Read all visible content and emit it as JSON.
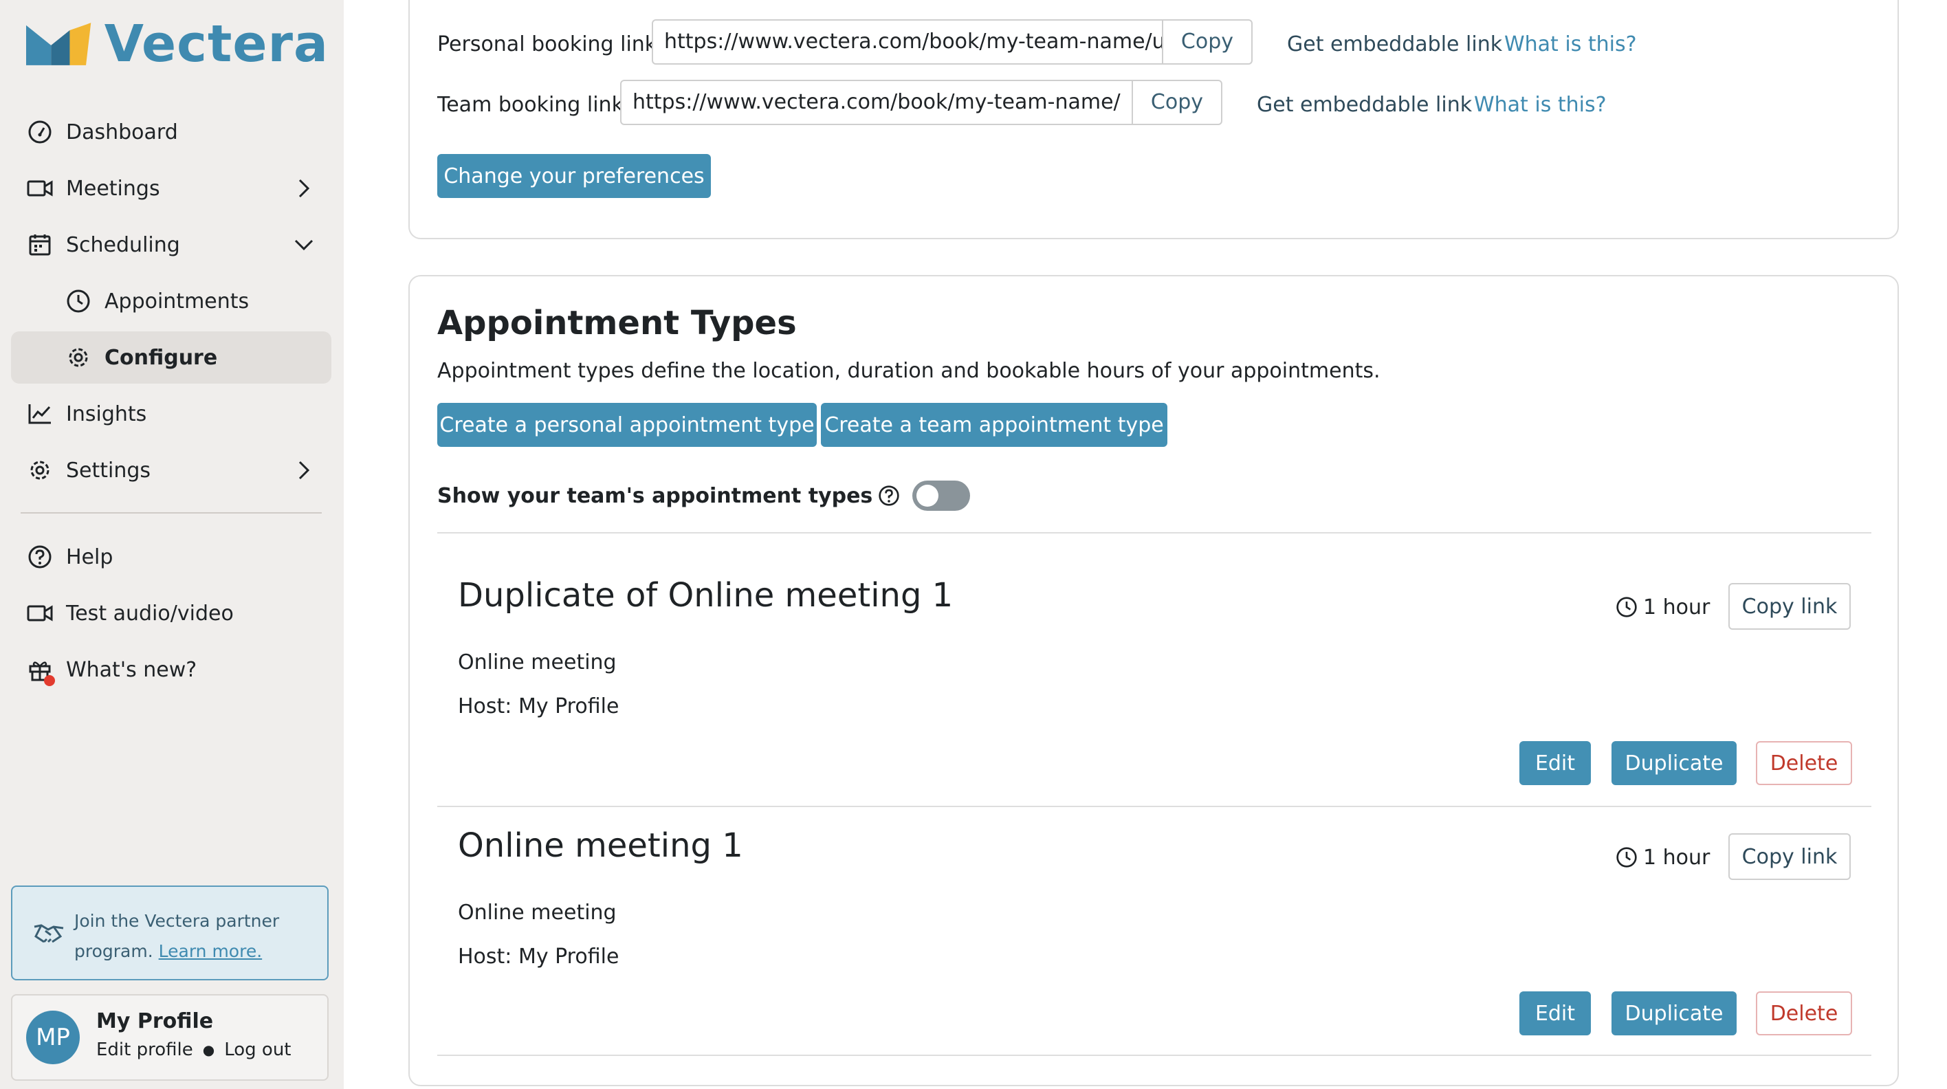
{
  "sidebar": {
    "brand": "Vectera",
    "items": [
      {
        "label": "Dashboard",
        "icon": "dashboard-icon"
      },
      {
        "label": "Meetings",
        "icon": "video-camera-icon"
      },
      {
        "label": "Scheduling",
        "icon": "calendar-icon"
      },
      {
        "label": "Appointments",
        "icon": "clock-icon"
      },
      {
        "label": "Configure",
        "icon": "gear-icon"
      },
      {
        "label": "Insights",
        "icon": "chart-icon"
      },
      {
        "label": "Settings",
        "icon": "gear-icon"
      },
      {
        "label": "Help",
        "icon": "help-icon"
      },
      {
        "label": "Test audio/video",
        "icon": "video-camera-icon"
      },
      {
        "label": "What's new?",
        "icon": "gift-icon"
      }
    ],
    "partner": {
      "text": "Join the Vectera partner program.",
      "link": "Learn more."
    },
    "profile": {
      "initials": "MP",
      "name": "My Profile",
      "edit": "Edit profile",
      "logout": "Log out"
    }
  },
  "links": {
    "personal_label": "Personal booking link:",
    "personal_value": "https://www.vectera.com/book/my-team-name/u/my-profile/",
    "team_label": "Team booking link:",
    "team_value": "https://www.vectera.com/book/my-team-name/",
    "copy": "Copy",
    "embed": "Get embeddable link",
    "what": "What is this?",
    "change_prefs": "Change your preferences"
  },
  "appointment_types": {
    "title": "Appointment Types",
    "description": "Appointment types define the location, duration and bookable hours of your appointments.",
    "create_personal": "Create a personal appointment type",
    "create_team": "Create a team appointment type",
    "show_team_label": "Show your team's appointment types",
    "show_team_enabled": false,
    "items": [
      {
        "title": "Duplicate of Online meeting 1",
        "duration": "1 hour",
        "type": "Online meeting",
        "host": "Host: My Profile"
      },
      {
        "title": "Online meeting 1",
        "duration": "1 hour",
        "type": "Online meeting",
        "host": "Host: My Profile"
      }
    ],
    "copy_link": "Copy link",
    "edit": "Edit",
    "duplicate": "Duplicate",
    "delete": "Delete"
  },
  "colors": {
    "accent": "#4390b4",
    "sidebar_bg": "#f0eeec",
    "danger": "#c0392b"
  }
}
